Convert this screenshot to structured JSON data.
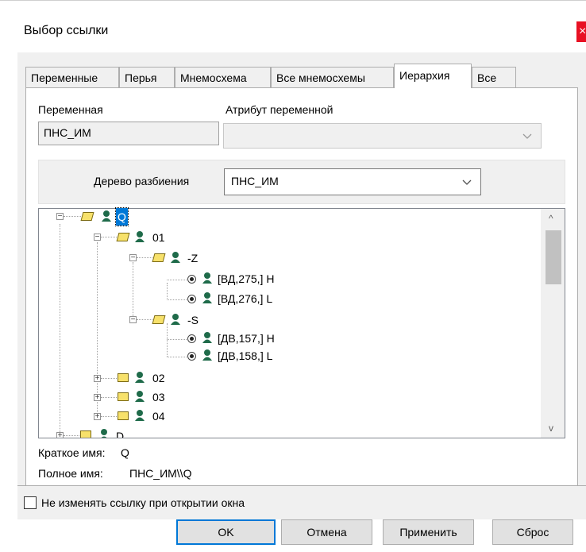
{
  "window": {
    "title": "Выбор ссылки",
    "close_label": "×"
  },
  "tabs": [
    {
      "label": "Переменные",
      "active": false
    },
    {
      "label": "Перья",
      "active": false
    },
    {
      "label": "Мнемосхема",
      "active": false
    },
    {
      "label": "Все мнемосхемы",
      "active": false
    },
    {
      "label": "Иерархия",
      "active": true
    },
    {
      "label": "Все",
      "active": false
    }
  ],
  "variable": {
    "label": "Переменная",
    "value": "ПНС_ИМ"
  },
  "attribute": {
    "label": "Атрибут переменной",
    "value": ""
  },
  "partition_tree": {
    "label": "Дерево разбиения",
    "value": "ПНС_ИМ"
  },
  "tree": {
    "nodes": [
      {
        "label": "Q",
        "expander": "minus",
        "folder": "open",
        "selected": true
      },
      {
        "label": "01",
        "expander": "minus",
        "folder": "open"
      },
      {
        "label": "-Z",
        "expander": "minus",
        "folder": "open"
      },
      {
        "label": "[ВД,275,] H",
        "leaf": true
      },
      {
        "label": "[ВД,276,] L",
        "leaf": true
      },
      {
        "label": "-S",
        "expander": "minus",
        "folder": "open"
      },
      {
        "label": "[ДВ,157,] H",
        "leaf": true
      },
      {
        "label": "[ДВ,158,] L",
        "leaf": true
      },
      {
        "label": "02",
        "expander": "plus",
        "folder": "closed"
      },
      {
        "label": "03",
        "expander": "plus",
        "folder": "closed"
      },
      {
        "label": "04",
        "expander": "plus",
        "folder": "closed"
      },
      {
        "label": "D",
        "expander": "plus",
        "folder": "closed"
      }
    ]
  },
  "info": {
    "short_name_label": "Краткое имя:",
    "short_name_value": "Q",
    "full_name_label": "Полное имя:",
    "full_name_value": "ПНС_ИМ\\\\Q"
  },
  "keep_link_checkbox": {
    "label": "Не изменять ссылку при открытии окна",
    "checked": false
  },
  "buttons": {
    "ok": "OK",
    "cancel": "Отмена",
    "apply": "Применить",
    "reset": "Сброс"
  },
  "colors": {
    "folder": "#f7e16b",
    "person": "#1f6b4a",
    "selection": "#0078d7",
    "close": "#e81123"
  },
  "icons": {
    "folder": "folder-icon",
    "person": "object-icon",
    "radio": "radio-icon"
  }
}
